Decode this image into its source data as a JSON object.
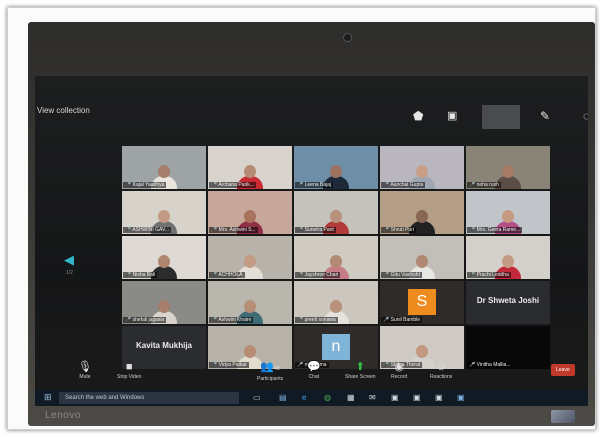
{
  "screen": {
    "view_label": "View collection",
    "nav_page": "1/2"
  },
  "top_icons": [
    "shield-icon",
    "screen-icon",
    "pen-icon",
    "circle-icon"
  ],
  "participants": [
    {
      "name": "Kajal Yaadhya",
      "bg": "#9ea3a6",
      "skin": "#a57d6a",
      "shirt": "#e9e4dc"
    },
    {
      "name": "Archana Parik...",
      "bg": "#d8d3cd",
      "skin": "#b68b73",
      "shirt": "#c92b33"
    },
    {
      "name": "Leena Bajaj",
      "bg": "#6f8ea7",
      "skin": "#9c7360",
      "shirt": "#1e2a3a"
    },
    {
      "name": "Aanchal Gupta",
      "bg": "#b9b6bf",
      "skin": "#c89e86",
      "shirt": "#9fa6b4"
    },
    {
      "name": "neha rush",
      "bg": "#8a8478",
      "skin": "#a57b65",
      "shirt": "#5b4c45"
    },
    {
      "name": "ASHWINI GAV...",
      "bg": "#d7d3cb",
      "skin": "#c29a84",
      "shirt": "#6f7072"
    },
    {
      "name": "Mrs. Ashwini S...",
      "bg": "#c6a79a",
      "skin": "#a8725c",
      "shirt": "#8f2f46"
    },
    {
      "name": "Sunetra Pant",
      "bg": "#c5c2bc",
      "skin": "#b8927c",
      "shirt": "#b33b3b"
    },
    {
      "name": "Shruti Puri",
      "bg": "#b49e86",
      "skin": "#8a6654",
      "shirt": "#222222"
    },
    {
      "name": "Mrs. Geeta Rame...",
      "bg": "#c1c4c8",
      "skin": "#c59a80",
      "shirt": "#b54f88"
    },
    {
      "name": "Nisha Bali",
      "bg": "#ded9d2",
      "skin": "#b0866f",
      "shirt": "#2c2c2c"
    },
    {
      "name": "ACHHOLA",
      "bg": "#b8b3aa",
      "skin": "#c49c84",
      "shirt": "#e4dfd6"
    },
    {
      "name": "Jayshree Chari",
      "bg": "#cfcac2",
      "skin": "#b28a72",
      "shirt": "#c67d88"
    },
    {
      "name": "Gitu Vashisht",
      "bg": "#c2bfb9",
      "skin": "#b08872",
      "shirt": "#e8e6e2"
    },
    {
      "name": "Prachi Leddha",
      "bg": "#d3d0ca",
      "skin": "#c39b84",
      "shirt": "#c4283b"
    },
    {
      "name": "shefali jagasia",
      "bg": "#8a8a86",
      "skin": "#a77e69",
      "shirt": "#d8d4cc"
    },
    {
      "name": "Ashwini Khaire",
      "bg": "#b9b6ad",
      "skin": "#b78f77",
      "shirt": "#3f6b74"
    },
    {
      "name": "preeti sonawa",
      "bg": "#cbc7bf",
      "skin": "#b8917b",
      "shirt": "#e5e2de"
    },
    {
      "name": "Sunil Bamble",
      "bg": "#2e2b28",
      "letter": "S",
      "tile": "#ef8c20"
    },
    {
      "name": "",
      "bg": "#2a2c2f",
      "label": "Dr Shweta Joshi"
    },
    {
      "name": "",
      "bg": "#2a2c2f",
      "label": "Kavita Mukhija"
    },
    {
      "name": "Vidya Patkar",
      "bg": "#b7b2a8",
      "skin": "#b68c74",
      "shirt": "#e2dccf"
    },
    {
      "name": "nidharima",
      "bg": "#2e2b28",
      "letter": "n",
      "tile": "#7fb3d7"
    },
    {
      "name": "Shilpa Thorat",
      "bg": "#cfcbc4",
      "skin": "#c29880",
      "shirt": "#d4d0cb"
    },
    {
      "name": "Vinitha Mallia...",
      "bg": "#080808",
      "skin": "",
      "shirt": ""
    }
  ],
  "toolbar": {
    "mute_label": "Mute",
    "video_label": "Stop Video",
    "participants_count": "40",
    "participants_label": "Participants",
    "chat_label": "Chat",
    "share_label": "Share Screen",
    "record_label": "Record",
    "reactions_label": "Reactions",
    "leave_label": "Leave"
  },
  "taskbar": {
    "search_placeholder": "Search the web and Windows"
  },
  "laptop": {
    "brand": "Lenovo"
  }
}
